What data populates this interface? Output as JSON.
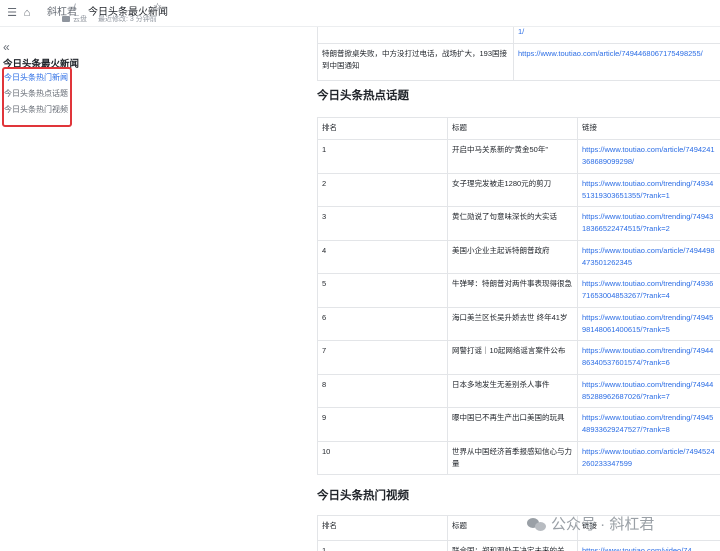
{
  "topbar": {
    "breadcrumb_root": "斜杠君",
    "separator": "/",
    "doc_title": "今日头条最火新闻",
    "space": "云盘",
    "modified": "最近修改: 3 分钟前"
  },
  "outline": {
    "title": "今日头条最火新闻",
    "items": [
      {
        "label": "今日头条热门新闻",
        "active": true
      },
      {
        "label": "今日头条热点话题",
        "active": false
      },
      {
        "label": "今日头条热门视频",
        "active": false
      }
    ]
  },
  "news_tail": {
    "top_link_fragment": "1/",
    "row": {
      "title": "特朗普掀桌失败，中方没打过电话，战场扩大，193国接到中国通知",
      "link": "https://www.toutiao.com/article/7494468067175498255/"
    }
  },
  "topics": {
    "heading": "今日头条热点话题",
    "headers": {
      "rank": "排名",
      "title": "标题",
      "link": "链接"
    },
    "rows": [
      {
        "rank": "1",
        "title": "开启中马关系新的“黄金50年”",
        "link": "https://www.toutiao.com/article/7494241368689099298/"
      },
      {
        "rank": "2",
        "title": "女子理完发被走1280元的剪刀",
        "link": "https://www.toutiao.com/trending/7493451319303651355/?rank=1"
      },
      {
        "rank": "3",
        "title": "黄仁勋说了句意味深长的大实话",
        "link": "https://www.toutiao.com/trending/7494318366522474515/?rank=2"
      },
      {
        "rank": "4",
        "title": "美国小企业主起诉特朗普政府",
        "link": "https://www.toutiao.com/article/7494498473501262345"
      },
      {
        "rank": "5",
        "title": "牛弹琴：特朗普对两件事表现得很急",
        "link": "https://www.toutiao.com/trending/7493671653004853267/?rank=4"
      },
      {
        "rank": "6",
        "title": "海口美兰区长吴升娇去世 终年41岁",
        "link": "https://www.toutiao.com/trending/7494598148061400615/?rank=5"
      },
      {
        "rank": "7",
        "title": "网警打谣｜10起网络谣言案件公布",
        "link": "https://www.toutiao.com/trending/7494486340537601574/?rank=6"
      },
      {
        "rank": "8",
        "title": "日本多地发生无差别杀人事件",
        "link": "https://www.toutiao.com/trending/7494485288962687026/?rank=7"
      },
      {
        "rank": "9",
        "title": "曝中国已不再生产出口美国的玩具",
        "link": "https://www.toutiao.com/trending/7494548933629247527/?rank=8"
      },
      {
        "rank": "10",
        "title": "世界从中国经济首季报感知信心与力量",
        "link": "https://www.toutiao.com/article/7494524260233347599"
      }
    ]
  },
  "videos": {
    "heading": "今日头条热门视频",
    "headers": {
      "rank": "排名",
      "title": "标题",
      "link": "链接"
    },
    "rows": [
      {
        "rank": "1",
        "title": "联合国：郑和观处于决定未来的关",
        "link": "https://www.toutiao.com/video/74"
      }
    ]
  },
  "watermark": {
    "text": "公众号 · 斜杠君"
  }
}
